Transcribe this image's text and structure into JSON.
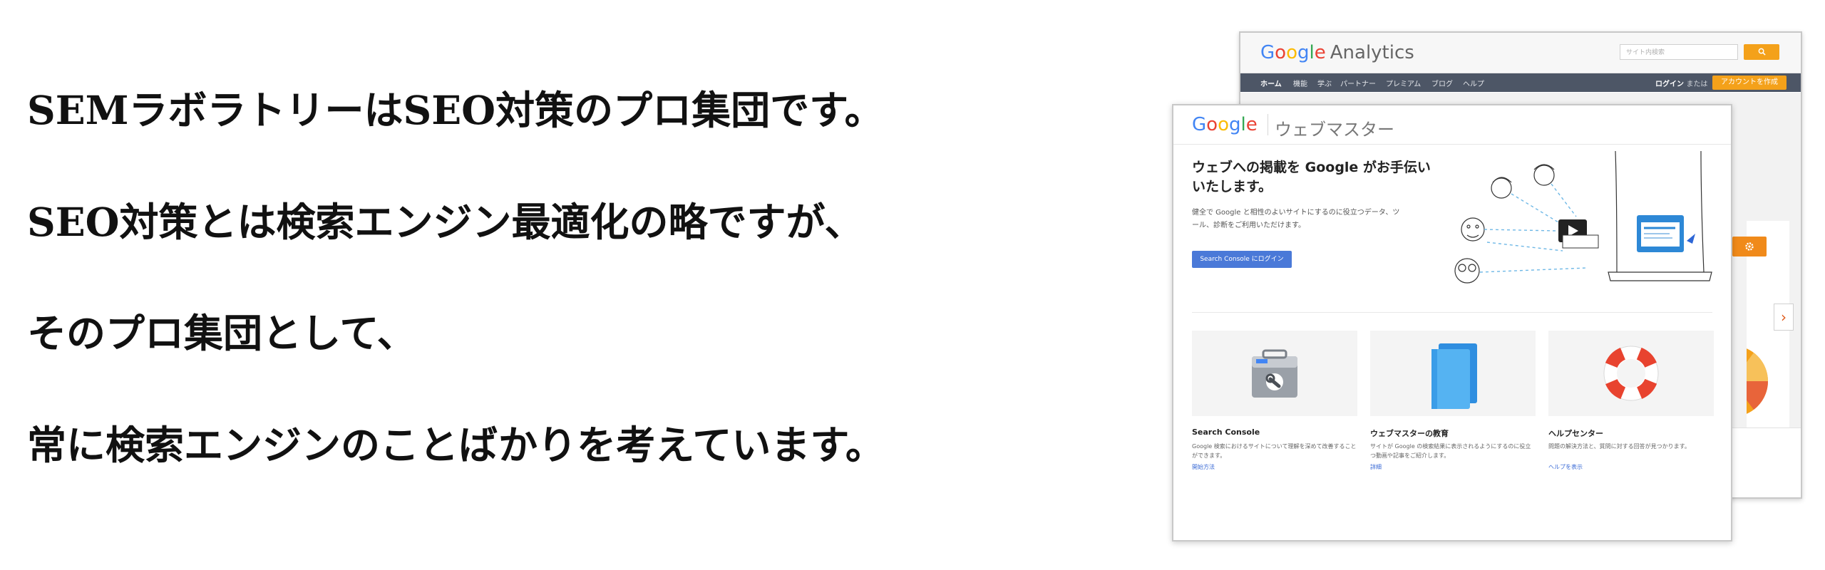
{
  "headline": {
    "line1": "SEMラボラトリーはSEO対策のプロ集団です。",
    "line2": "SEO対策とは検索エンジン最適化の略ですが、",
    "line3": "そのプロ集団として、",
    "line4": "常に検索エンジンのことばかりを考えています。"
  },
  "analytics": {
    "logo_google": [
      "G",
      "o",
      "o",
      "g",
      "l",
      "e"
    ],
    "logo_product": "Analytics",
    "search_placeholder": "サイト内検索",
    "search_button_icon": "search-icon",
    "nav": [
      "ホーム",
      "機能",
      "学ぶ",
      "パートナー",
      "プレミアム",
      "ブログ",
      "ヘルプ"
    ],
    "login": "ログイン",
    "or": "または",
    "create_account": "アカウントを作成",
    "accent_color": "#f4a11a",
    "nav_color": "#4d5666"
  },
  "webmaster": {
    "logo": "Google",
    "product": "ウェブマスター",
    "hero_title": "ウェブへの掲載を Google がお手伝いいたします。",
    "hero_desc": "健全で Google と相性のよいサイトにするのに役立つデータ、ツール、診断をご利用いただけます。",
    "login_button": "Search Console にログイン",
    "cards": [
      {
        "title": "Search Console",
        "desc": "Google 検索におけるサイトについて理解を深めて改善することができます。",
        "link": "開始方法",
        "icon": "toolbox-icon"
      },
      {
        "title": "ウェブマスターの教育",
        "desc": "サイトが Google の検索結果に表示されるようにするのに役立つ動画や記事をご紹介します。",
        "link": "詳細",
        "icon": "book-icon"
      },
      {
        "title": "ヘルプセンター",
        "desc": "問題の解決方法と、質問に対する回答が見つかります。",
        "link": "ヘルプを表示",
        "icon": "lifebuoy-icon"
      }
    ],
    "button_color": "#4a79d8"
  }
}
